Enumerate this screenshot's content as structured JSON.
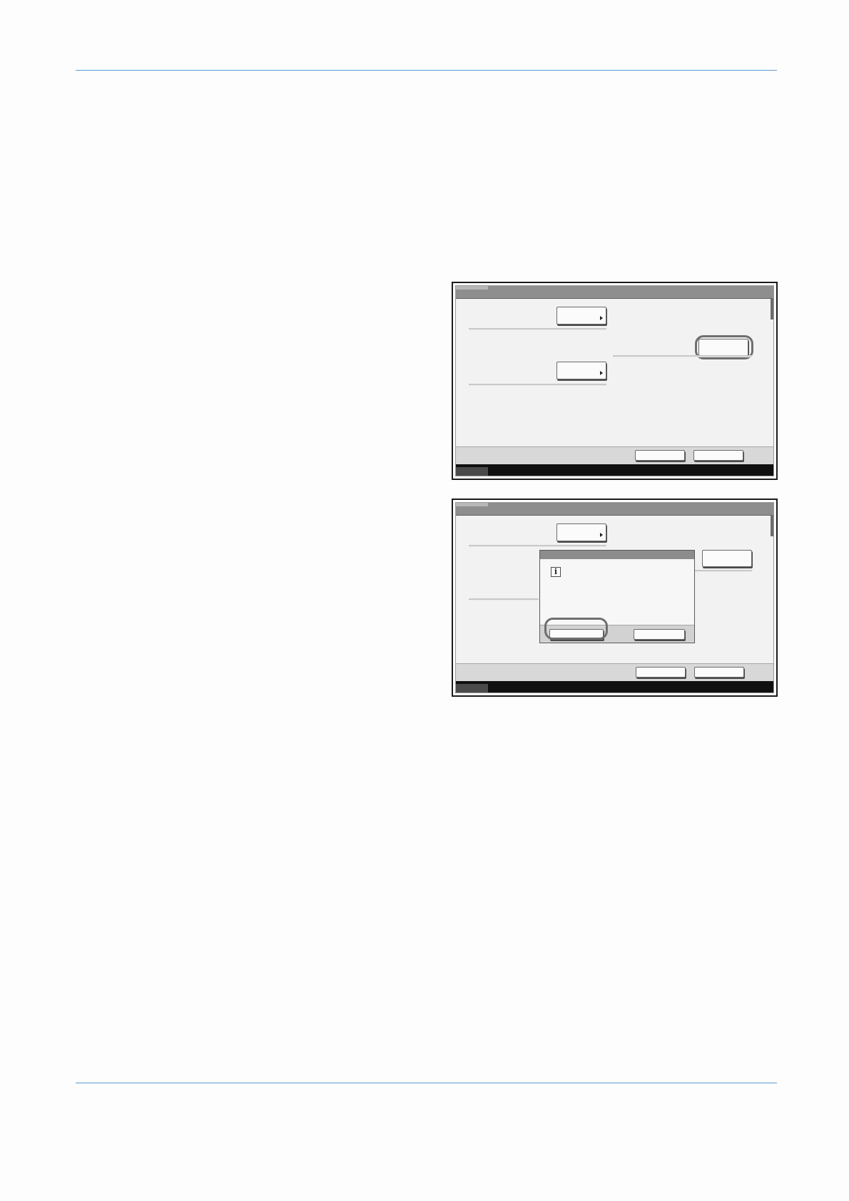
{
  "colors": {
    "rule": "#5b9bd5",
    "panel_border": "#1b1b1b",
    "panel_bg": "#f2f2f2",
    "titlebar": "#8e8e8e",
    "highlight": "#6f6f6f"
  },
  "panel_1": {
    "buttons": [
      "arrow-button",
      "arrow-button",
      "highlighted-button",
      "bottom-button",
      "bottom-button"
    ]
  },
  "panel_2": {
    "dialog": {
      "icon": "info-icon",
      "icon_glyph": "i"
    }
  }
}
